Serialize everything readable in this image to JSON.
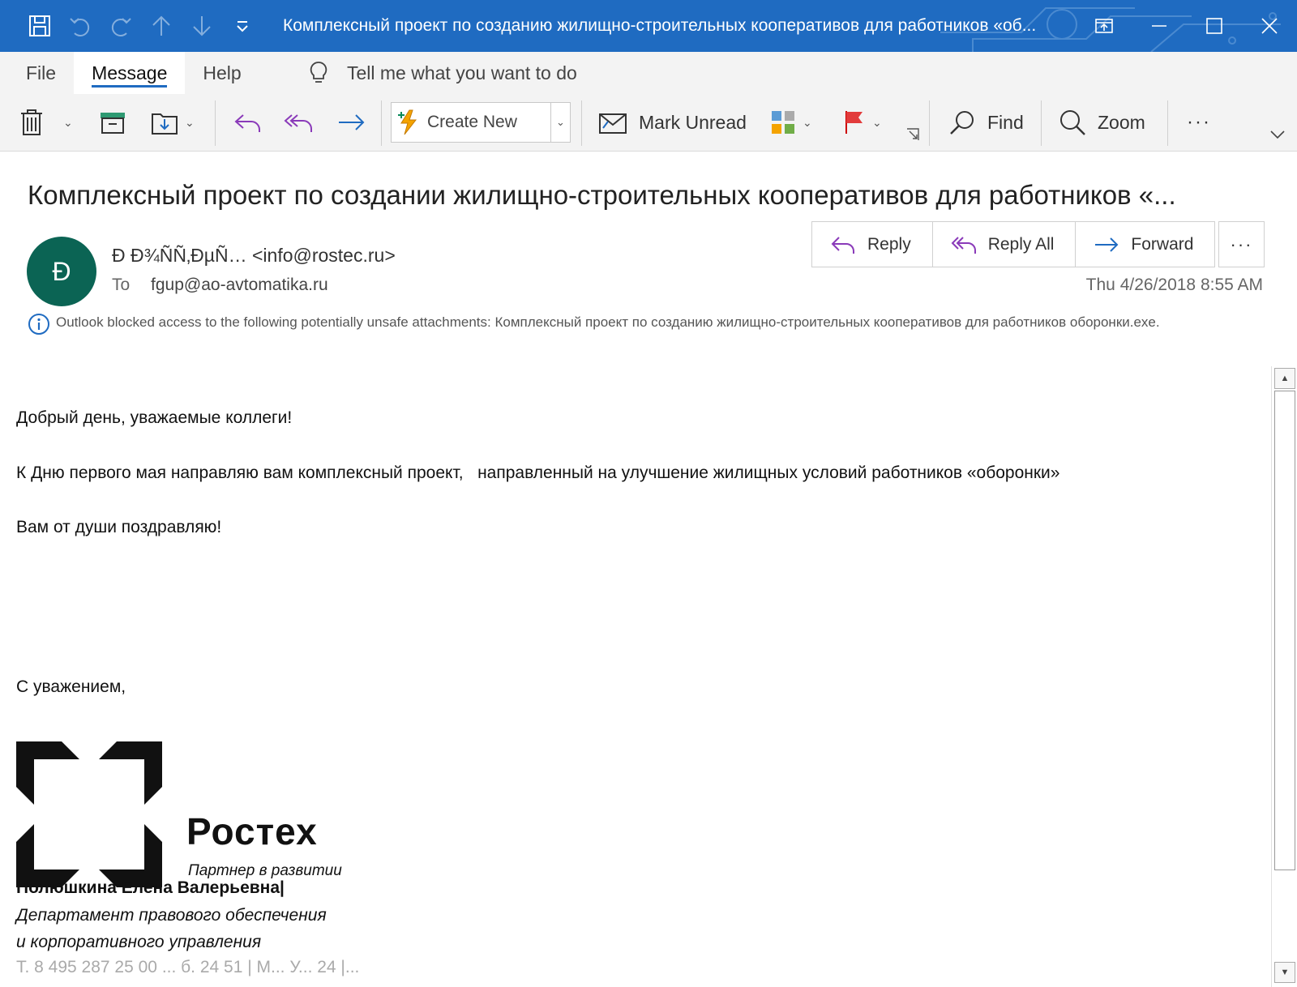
{
  "window": {
    "title": "Комплексный проект по созданию жилищно-строительных кооперативов для работников «об..."
  },
  "quick_access": {
    "icons": [
      "save-icon",
      "undo-icon",
      "redo-icon",
      "previous-item-icon",
      "next-item-icon",
      "customize-qat-icon"
    ]
  },
  "ribbon": {
    "tabs": [
      "File",
      "Message",
      "Help"
    ],
    "active_tab": "Message",
    "tell_me": "Tell me what you want to do",
    "create_new": "Create New",
    "mark_unread": "Mark Unread",
    "find": "Find",
    "zoom": "Zoom",
    "more": "···"
  },
  "message": {
    "subject": "Комплексный проект по создании жилищно-строительных кооперативов для работников «...",
    "avatar_initial": "Ð",
    "sender": "Ð Ð¾ÑÑ‚ÐµÑ… <info@rostec.ru>",
    "to_label": "To",
    "to": "fgup@ao-avtomatika.ru",
    "date": "Thu 4/26/2018 8:55 AM",
    "reply": "Reply",
    "reply_all": "Reply All",
    "forward": "Forward",
    "more": "···",
    "infobar": "Outlook blocked access to the following potentially unsafe attachments: Комплексный проект по созданию жилищно-строительных кооперативов для работников оборонки.exe."
  },
  "body": {
    "greeting": "Добрый день, уважаемые коллеги!",
    "line1": "К Дню первого мая направляю вам комплексный проект,   направленный на улучшение жилищных условий работников «оборонки»",
    "line2": "Вам от души поздравляю!",
    "closing": "С уважением,",
    "brand_name": "Ростех",
    "brand_tagline": "Партнер в развитии",
    "sig_name": "Полюшкина Елена Валерьевна|",
    "sig_dept1": "Департамент правового обеспечения",
    "sig_dept2": "и корпоративного управления",
    "sig_contact": "Т. 8 495 287 25 00 ... б. 24 51 | М... У... 24 |..."
  },
  "colors": {
    "titlebar": "#1f6bc1",
    "avatar": "#0b6454",
    "reply_purple": "#8a3ab9",
    "forward_blue": "#1f6bc1"
  }
}
